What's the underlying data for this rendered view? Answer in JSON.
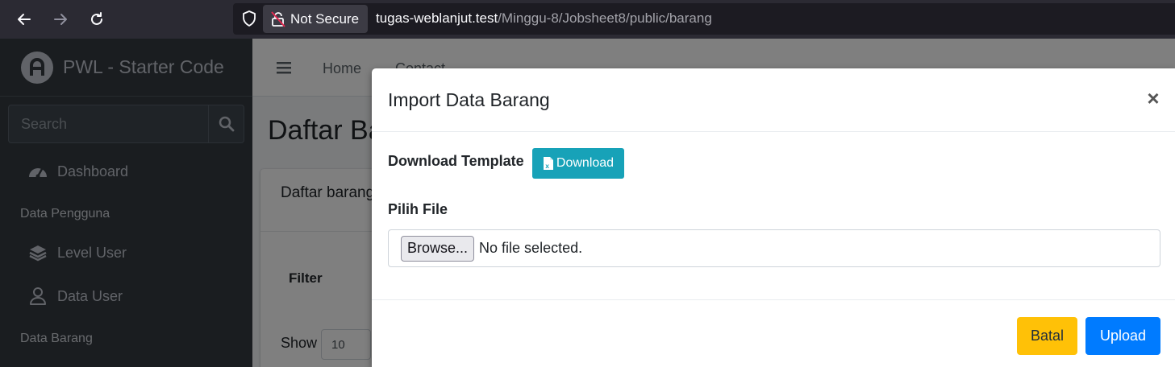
{
  "browser": {
    "security_label": "Not Secure",
    "url_host": "tugas-weblanjut.test",
    "url_path": "/Minggu-8/Jobsheet8/public/barang"
  },
  "sidebar": {
    "brand": "PWL - Starter Code",
    "search_placeholder": "Search",
    "items": [
      {
        "label": "Dashboard",
        "icon": "tachometer-icon"
      },
      {
        "header": "Data Pengguna"
      },
      {
        "label": "Level User",
        "icon": "layer-group-icon"
      },
      {
        "label": "Data User",
        "icon": "user-icon"
      },
      {
        "header": "Data Barang"
      }
    ]
  },
  "topnav": {
    "links": [
      "Home",
      "Contact"
    ]
  },
  "page": {
    "title": "Daftar Barang",
    "card_title": "Daftar barang",
    "filter_label": "Filter",
    "show_label": "Show",
    "show_value": "10"
  },
  "modal": {
    "title": "Import Data Barang",
    "close_symbol": "×",
    "download_template_label": "Download Template",
    "download_button": "Download",
    "file_label": "Pilih File",
    "browse_button": "Browse...",
    "file_status": "No file selected.",
    "cancel_button": "Batal",
    "upload_button": "Upload"
  },
  "colors": {
    "info": "#17a2b8",
    "warning": "#ffc107",
    "primary": "#007bff",
    "sidebar": "#343a40"
  }
}
